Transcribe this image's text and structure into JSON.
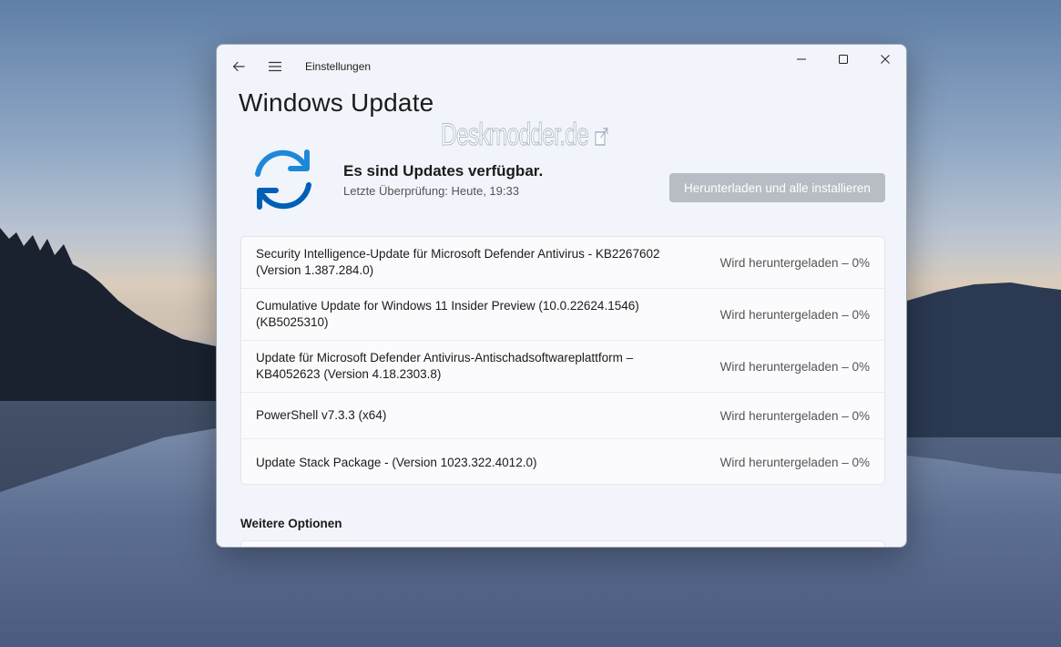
{
  "window": {
    "app_title": "Einstellungen",
    "page_title": "Windows Update"
  },
  "status": {
    "heading": "Es sind Updates verfügbar.",
    "last_check": "Letzte Überprüfung: Heute, 19:33",
    "primary_button": "Herunterladen und alle installieren"
  },
  "updates": [
    {
      "line1": "Security Intelligence-Update für Microsoft Defender Antivirus - KB2267602",
      "line2": "(Version 1.387.284.0)",
      "status": "Wird heruntergeladen – 0%",
      "progress": 0
    },
    {
      "line1": "Cumulative Update for Windows 11 Insider Preview (10.0.22624.1546)",
      "line2": "(KB5025310)",
      "status": "Wird heruntergeladen – 0%",
      "progress": 0
    },
    {
      "line1": "Update für Microsoft Defender Antivirus-Antischadsoftwareplattform –",
      "line2": "KB4052623 (Version 4.18.2303.8)",
      "status": "Wird heruntergeladen – 0%",
      "progress": 0
    },
    {
      "line1": "PowerShell v7.3.3 (x64)",
      "line2": "",
      "status": "Wird heruntergeladen – 0%",
      "progress": 0
    },
    {
      "line1": "Update Stack Package - (Version 1023.322.4012.0)",
      "line2": "",
      "status": "Wird heruntergeladen – 0%",
      "progress": 0
    }
  ],
  "section": {
    "more_options": "Weitere Optionen"
  },
  "watermark": "Deskmodder.de",
  "icons": {
    "back": "back-arrow-icon",
    "menu": "hamburger-menu-icon",
    "minimize": "minimize-icon",
    "maximize": "maximize-icon",
    "close": "close-icon",
    "sync": "sync-arrows-icon",
    "external": "external-link-icon"
  },
  "colors": {
    "accent": "#1e88d8",
    "accent_dark": "#005fb8",
    "button_disabled": "#b8bcc4",
    "window_bg": "#f1f4fa"
  }
}
